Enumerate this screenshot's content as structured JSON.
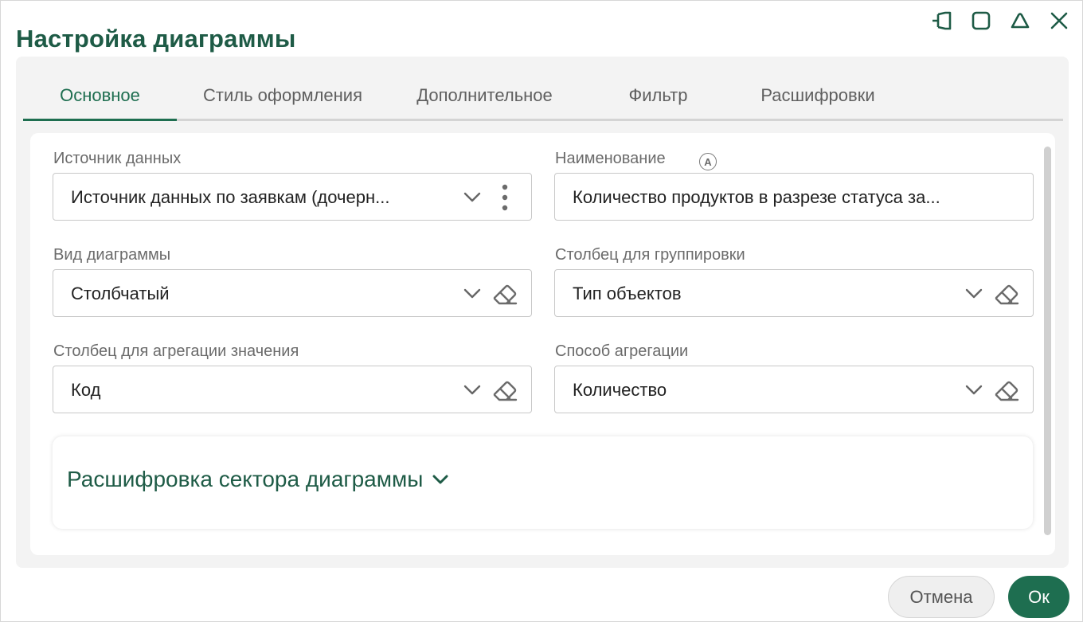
{
  "dialog": {
    "title": "Настройка диаграммы"
  },
  "window_controls": [
    "pin-icon",
    "maximize-icon",
    "collapse-icon",
    "close-icon"
  ],
  "tabs": [
    {
      "label": "Основное",
      "active": true
    },
    {
      "label": "Стиль оформления",
      "active": false
    },
    {
      "label": "Дополнительное",
      "active": false
    },
    {
      "label": "Фильтр",
      "active": false
    },
    {
      "label": "Расшифровки",
      "active": false
    }
  ],
  "form": {
    "data_source": {
      "label": "Источник данных",
      "value": "Источник данных по заявкам (дочерн..."
    },
    "name": {
      "label": "Наименование",
      "badge": "A",
      "value": "Количество продуктов в разрезе статуса за..."
    },
    "chart_type": {
      "label": "Вид диаграммы",
      "value": "Столбчатый"
    },
    "group_column": {
      "label": "Столбец для группировки",
      "value": "Тип объектов"
    },
    "agg_column": {
      "label": "Столбец для агрегации значения",
      "value": "Код"
    },
    "agg_method": {
      "label": "Способ агрегации",
      "value": "Количество"
    }
  },
  "section": {
    "title": "Расшифровка сектора диаграммы"
  },
  "buttons": {
    "cancel": "Отмена",
    "ok": "Ок"
  },
  "colors": {
    "accent": "#1e6e50",
    "title": "#1e5b46"
  }
}
